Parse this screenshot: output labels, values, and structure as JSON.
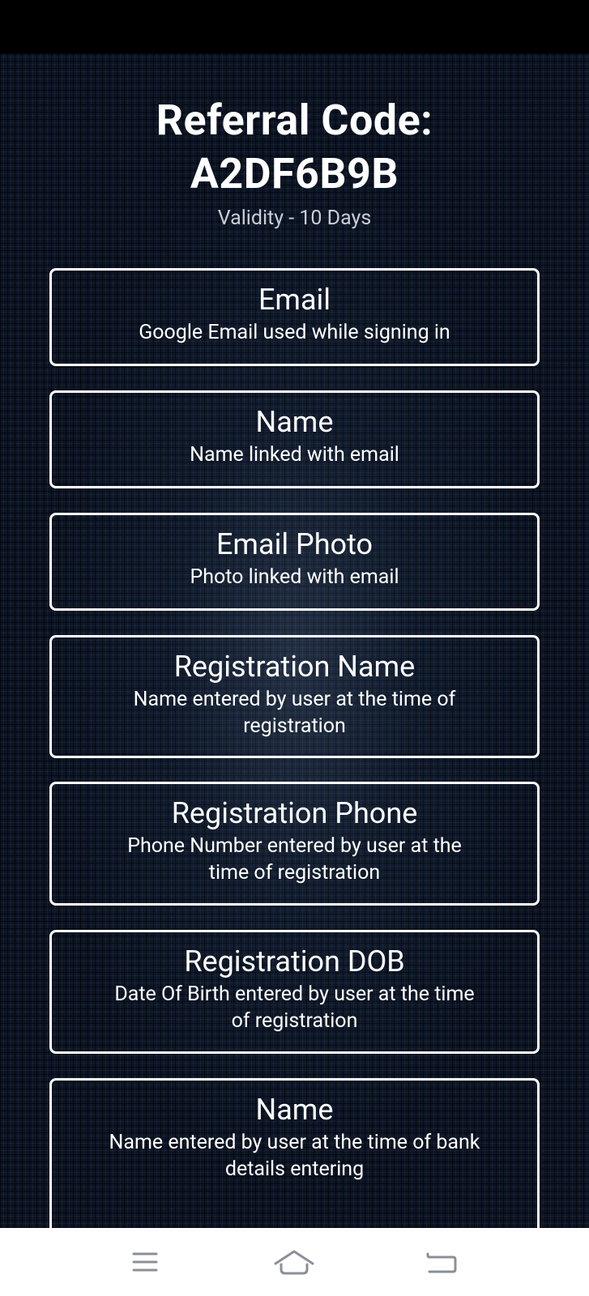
{
  "header": {
    "title_line1": "Referral Code:",
    "title_line2": "A2DF6B9B",
    "validity": "Validity - 10 Days"
  },
  "cards": [
    {
      "title": "Email",
      "desc_line1": "Google Email used while signing in",
      "desc_line2": ""
    },
    {
      "title": "Name",
      "desc_line1": "Name linked with email",
      "desc_line2": ""
    },
    {
      "title": "Email Photo",
      "desc_line1": "Photo linked with email",
      "desc_line2": ""
    },
    {
      "title": "Registration Name",
      "desc_line1": "Name entered by user at the time of",
      "desc_line2": "registration"
    },
    {
      "title": "Registration Phone",
      "desc_line1": "Phone Number entered by user at the",
      "desc_line2": "time of registration"
    },
    {
      "title": "Registration DOB",
      "desc_line1": "Date Of Birth entered by user at the time",
      "desc_line2": "of registration"
    },
    {
      "title": "Name",
      "desc_line1": "Name entered by user at the time of bank",
      "desc_line2": "details entering"
    }
  ],
  "nav": {
    "menu_icon": "menu-icon",
    "home_icon": "home-icon",
    "back_icon": "back-icon"
  }
}
